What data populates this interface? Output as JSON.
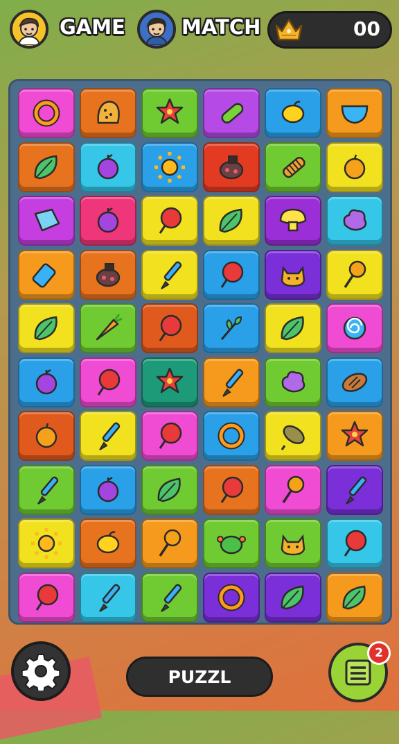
{
  "header": {
    "player1": {
      "label": "GAME",
      "avatar_icon": "boy-avatar-icon",
      "bg": "#f6c22a"
    },
    "player2": {
      "label": "MATCH",
      "avatar_icon": "boy-avatar-icon",
      "bg": "#3e6fc7"
    },
    "score": {
      "value": "00",
      "icon": "gold-crown-icon"
    }
  },
  "board": {
    "rows": 10,
    "cols": 6,
    "tiles": [
      [
        {
          "color": "#f04bd3",
          "icon": "ring"
        },
        {
          "color": "#e8731f",
          "icon": "sponge"
        },
        {
          "color": "#6fcb31",
          "icon": "star-flower"
        },
        {
          "color": "#b54ae6",
          "icon": "pickle"
        },
        {
          "color": "#2aa0e8",
          "icon": "lemon"
        },
        {
          "color": "#f59a1c",
          "icon": "bowl"
        }
      ],
      [
        {
          "color": "#e8731f",
          "icon": "leaf"
        },
        {
          "color": "#35c6e8",
          "icon": "berry"
        },
        {
          "color": "#2aa0e8",
          "icon": "sun"
        },
        {
          "color": "#e33b22",
          "icon": "bug"
        },
        {
          "color": "#6fcb31",
          "icon": "corn"
        },
        {
          "color": "#f2e11e",
          "icon": "orange"
        }
      ],
      [
        {
          "color": "#c43ee0",
          "icon": "cube"
        },
        {
          "color": "#f0367a",
          "icon": "berry"
        },
        {
          "color": "#f2e11e",
          "icon": "balloon"
        },
        {
          "color": "#f2e11e",
          "icon": "leaf"
        },
        {
          "color": "#9a2fd8",
          "icon": "mushroom"
        },
        {
          "color": "#35c6e8",
          "icon": "blob"
        }
      ],
      [
        {
          "color": "#f59a1c",
          "icon": "bottle"
        },
        {
          "color": "#e8731f",
          "icon": "bug"
        },
        {
          "color": "#f2e11e",
          "icon": "brush"
        },
        {
          "color": "#2aa0e8",
          "icon": "balloon"
        },
        {
          "color": "#7a2fd8",
          "icon": "cat"
        },
        {
          "color": "#f2e11e",
          "icon": "lollipop"
        }
      ],
      [
        {
          "color": "#f2e11e",
          "icon": "leaf"
        },
        {
          "color": "#6fcb31",
          "icon": "carrot"
        },
        {
          "color": "#e05a1e",
          "icon": "balloon"
        },
        {
          "color": "#2aa0e8",
          "icon": "herb"
        },
        {
          "color": "#f2e11e",
          "icon": "leaf"
        },
        {
          "color": "#f04bd3",
          "icon": "swirl"
        }
      ],
      [
        {
          "color": "#2aa0e8",
          "icon": "berry"
        },
        {
          "color": "#f04bd3",
          "icon": "balloon"
        },
        {
          "color": "#1d9a78",
          "icon": "star-flower"
        },
        {
          "color": "#f59a1c",
          "icon": "brush"
        },
        {
          "color": "#6fcb31",
          "icon": "blob"
        },
        {
          "color": "#2aa0e8",
          "icon": "bread"
        }
      ],
      [
        {
          "color": "#e05a1e",
          "icon": "orange"
        },
        {
          "color": "#f2e11e",
          "icon": "brush"
        },
        {
          "color": "#f04bd3",
          "icon": "balloon"
        },
        {
          "color": "#2aa0e8",
          "icon": "ring"
        },
        {
          "color": "#f2e11e",
          "icon": "seed"
        },
        {
          "color": "#f59a1c",
          "icon": "star-flower"
        }
      ],
      [
        {
          "color": "#6fcb31",
          "icon": "brush"
        },
        {
          "color": "#2aa0e8",
          "icon": "berry"
        },
        {
          "color": "#6fcb31",
          "icon": "leaf"
        },
        {
          "color": "#e8731f",
          "icon": "balloon"
        },
        {
          "color": "#f04bd3",
          "icon": "lollipop"
        },
        {
          "color": "#7a2fd8",
          "icon": "brush"
        }
      ],
      [
        {
          "color": "#f2e11e",
          "icon": "sun"
        },
        {
          "color": "#e8731f",
          "icon": "lemon"
        },
        {
          "color": "#f59a1c",
          "icon": "lollipop"
        },
        {
          "color": "#6fcb31",
          "icon": "turtle"
        },
        {
          "color": "#6fcb31",
          "icon": "cat"
        },
        {
          "color": "#35c6e8",
          "icon": "balloon"
        }
      ],
      [
        {
          "color": "#f04bd3",
          "icon": "balloon"
        },
        {
          "color": "#35c6e8",
          "icon": "brush"
        },
        {
          "color": "#6fcb31",
          "icon": "brush"
        },
        {
          "color": "#7a2fd8",
          "icon": "ring"
        },
        {
          "color": "#7a2fd8",
          "icon": "leaf"
        },
        {
          "color": "#f59a1c",
          "icon": "leaf"
        }
      ]
    ]
  },
  "footer": {
    "settings_icon": "gear-icon",
    "center_label": "PUZZL",
    "menu_icon": "list-icon",
    "badge_count": "2"
  }
}
